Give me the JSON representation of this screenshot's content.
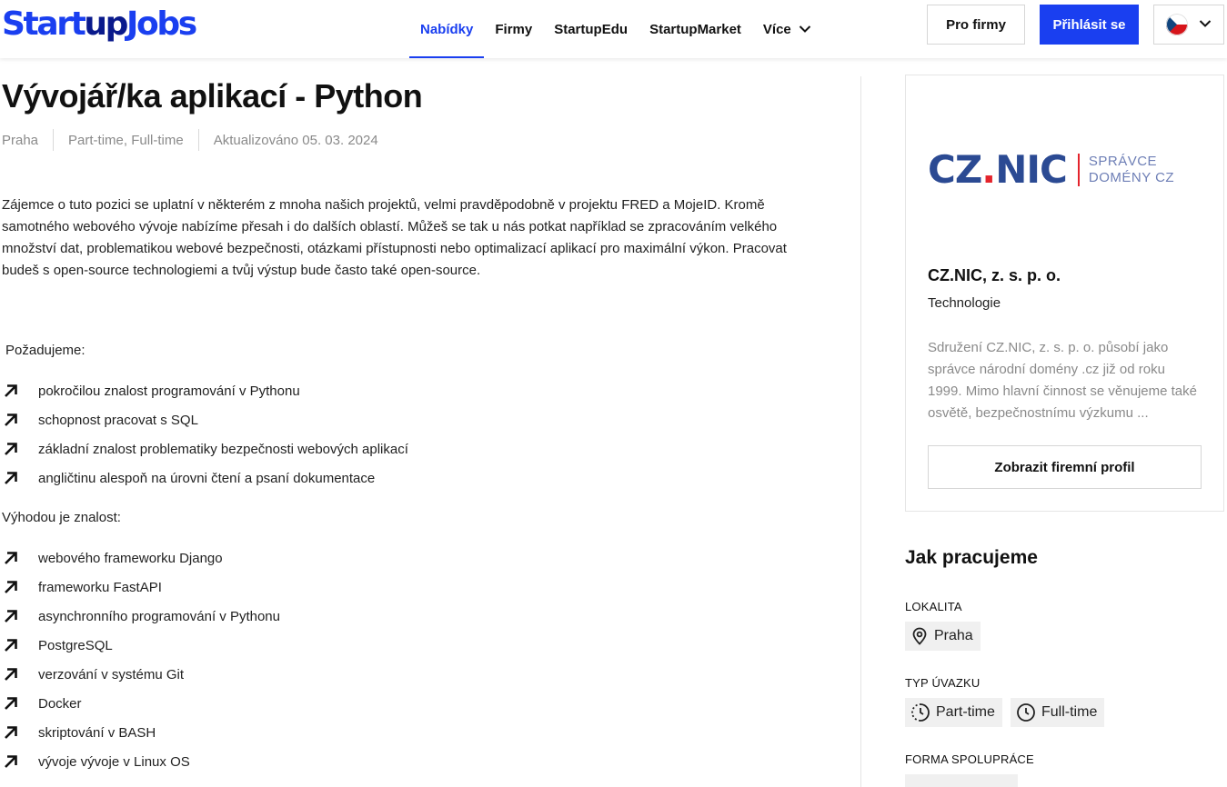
{
  "header": {
    "logo": {
      "part1": "Startup",
      "part2": "up",
      "part3": "Jobs"
    },
    "nav": [
      {
        "label": "Nabídky",
        "active": true
      },
      {
        "label": "Firmy"
      },
      {
        "label": "StartupEdu"
      },
      {
        "label": "StartupMarket"
      },
      {
        "label": "Více",
        "dropdown": true
      }
    ],
    "for_companies": "Pro firmy",
    "login": "Přihlásit se",
    "language": "cs",
    "accent_color": "#1a3ff0"
  },
  "job": {
    "title": "Vývojář/ka aplikací - Python",
    "meta": {
      "location": "Praha",
      "type": "Part-time, Full-time",
      "updated": "Aktualizováno 05. 03. 2024"
    },
    "intro": "Zájemce o tuto pozici se uplatní v některém z mnoha našich projektů, velmi pravděpodobně v projektu FRED a MojeID. Kromě samotného webového vývoje nabízíme přesah i do dalších oblastí. Můžeš se tak u nás potkat například se zpracováním velkého množství dat, problematikou webové bezpečnosti, otázkami přístupnosti nebo optimalizací aplikací pro maximální výkon. Pracovat budeš s open-source technologiemi a tvůj výstup bude často také open-source.",
    "requirements_label": "Požadujeme:",
    "requirements": [
      "pokročilou znalost programování v Pythonu",
      "schopnost pracovat s SQL",
      "základní znalost problematiky bezpečnosti webových aplikací",
      "angličtinu alespoň na úrovni čtení a psaní dokumentace"
    ],
    "advantages_label": "Výhodou je znalost:",
    "advantages": [
      "webového frameworku Django",
      "frameworku FastAPI",
      "asynchronního programování v Pythonu",
      "PostgreSQL",
      "verzování v systému Git",
      "Docker",
      "skriptování v BASH",
      "vývoje vývoje v Linux OS"
    ]
  },
  "company": {
    "logo_text": "CZ.NIC",
    "logo_sub1": "SPRÁVCE",
    "logo_sub2": "DOMÉNY CZ",
    "name": "CZ.NIC, z. s. p. o.",
    "category": "Technologie",
    "description": "Sdružení CZ.NIC, z. s. p. o. působí jako správce národní domény .cz již od roku 1999. Mimo hlavní činnost se věnujeme také osvětě, bezpečnostnímu výzkumu ...",
    "profile_button": "Zobrazit firemní profil"
  },
  "how_we_work": {
    "title": "Jak pracujeme",
    "location_label": "LOKALITA",
    "location_value": "Praha",
    "job_type_label": "TYP ÚVAZKU",
    "job_types": [
      "Part-time",
      "Full-time"
    ],
    "cooperation_label": "FORMA SPOLUPRÁCE"
  }
}
